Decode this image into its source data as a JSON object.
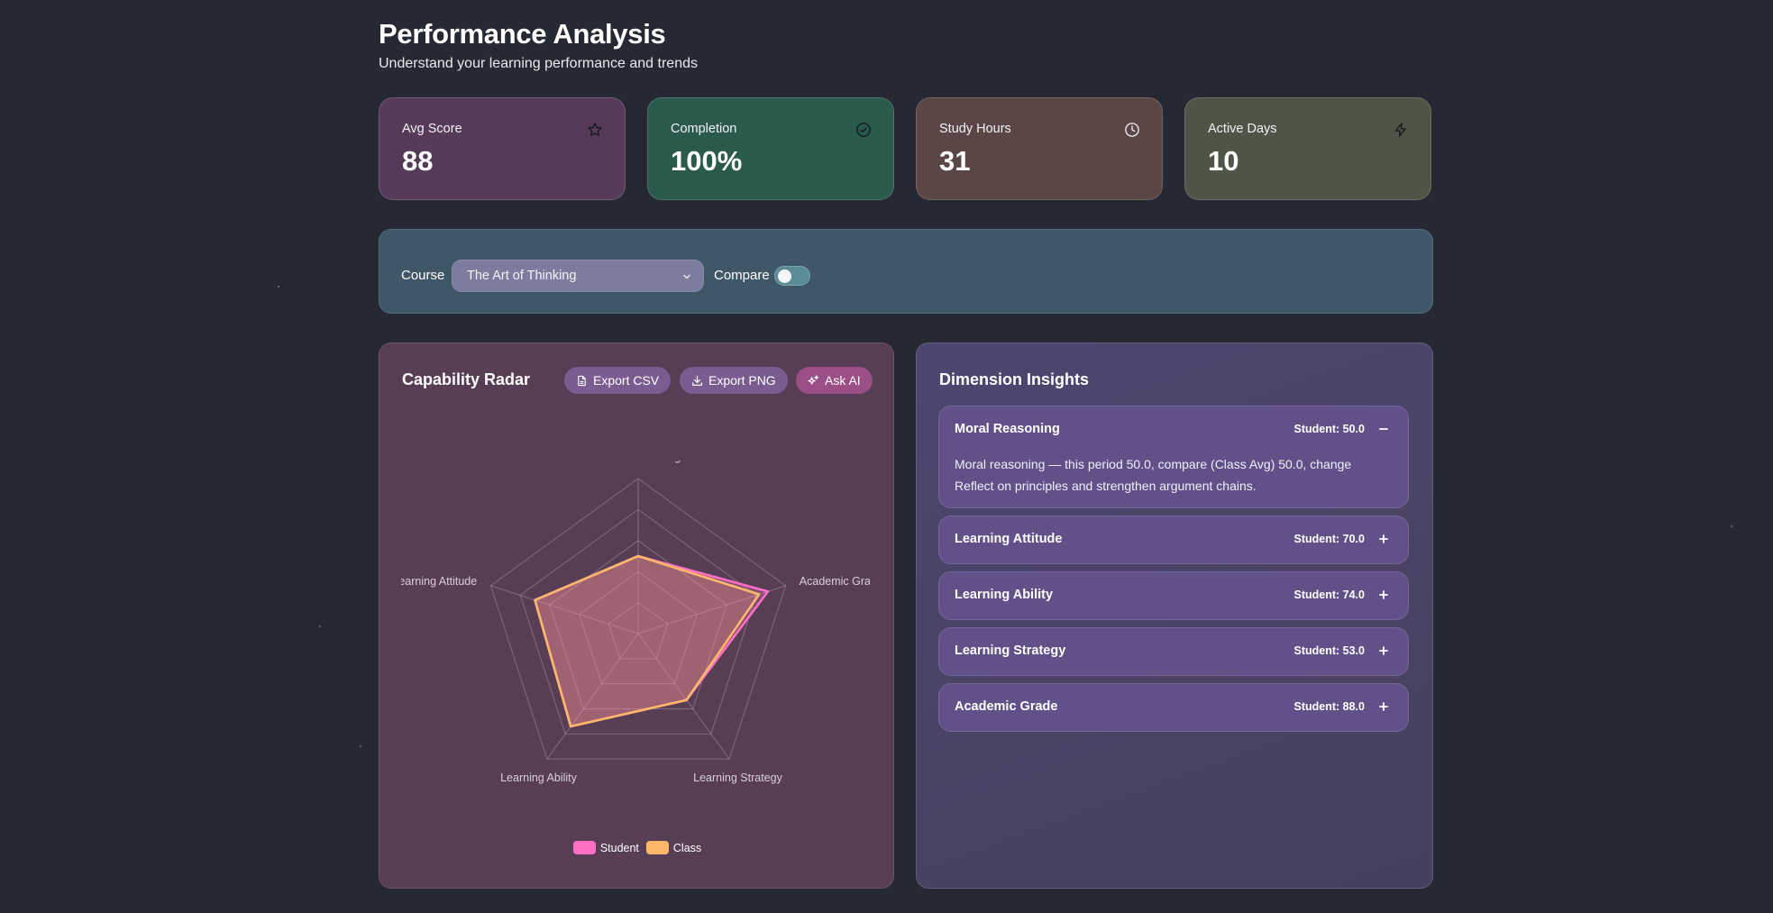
{
  "header": {
    "title": "Performance Analysis",
    "subtitle": "Understand your learning performance and trends"
  },
  "stats": [
    {
      "label": "Avg Score",
      "value": "88",
      "icon": "star-icon",
      "color": "#563b58"
    },
    {
      "label": "Completion",
      "value": "100%",
      "icon": "check-circle-icon",
      "color": "#2a5a4b"
    },
    {
      "label": "Study Hours",
      "value": "31",
      "icon": "clock-icon",
      "color": "#5a4745"
    },
    {
      "label": "Active Days",
      "value": "10",
      "icon": "lightning-icon",
      "color": "#4e5446"
    }
  ],
  "filters": {
    "course_label": "Course",
    "course_value": "The Art of Thinking",
    "compare_label": "Compare",
    "compare_on": false
  },
  "radar": {
    "title": "Capability Radar",
    "buttons": {
      "export_csv": "Export CSV",
      "export_png": "Export PNG",
      "ask_ai": "Ask AI"
    }
  },
  "chart_data": {
    "type": "radar",
    "axes": [
      "Moral Reasoning",
      "Academic Grade",
      "Learning Strategy",
      "Learning Ability",
      "Learning Attitude"
    ],
    "max": 100,
    "series": [
      {
        "name": "Student",
        "values": [
          50,
          88,
          53,
          74,
          70
        ],
        "color": "#ff6fc4"
      },
      {
        "name": "Class",
        "values": [
          50,
          82,
          53,
          74,
          70
        ],
        "color": "#ffb86b"
      }
    ]
  },
  "insights": {
    "title": "Dimension Insights",
    "items": [
      {
        "name": "Moral Reasoning",
        "score": "Student: 50.0",
        "expanded": true,
        "detail": "Moral reasoning — this period 50.0, compare (Class Avg) 50.0, change Reflect on principles and strengthen argument chains."
      },
      {
        "name": "Learning Attitude",
        "score": "Student: 70.0",
        "expanded": false
      },
      {
        "name": "Learning Ability",
        "score": "Student: 74.0",
        "expanded": false
      },
      {
        "name": "Learning Strategy",
        "score": "Student: 53.0",
        "expanded": false
      },
      {
        "name": "Academic Grade",
        "score": "Student: 88.0",
        "expanded": false
      }
    ]
  }
}
